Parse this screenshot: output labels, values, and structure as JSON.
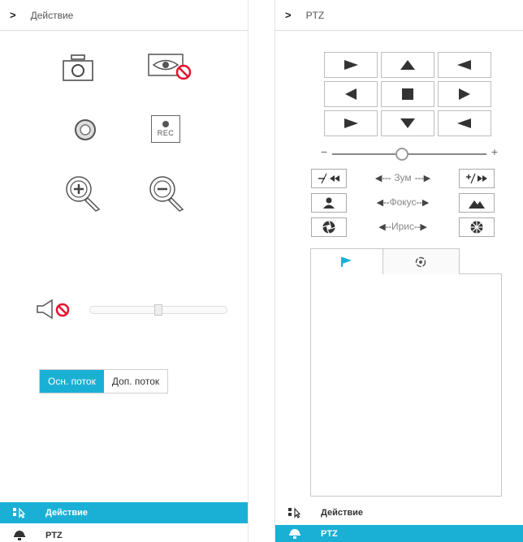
{
  "left_panel": {
    "header": {
      "chevron": ">",
      "title": "Действие"
    },
    "actions": {
      "snapshot": "camera-icon",
      "privacy_off": "eye-disabled-icon",
      "record_local": "record-circle-icon",
      "record_rec": "rec-icon",
      "rec_text": "REC",
      "zoom_in": "zoom-in-icon",
      "zoom_out": "zoom-out-icon"
    },
    "volume": {
      "icon": "speaker-muted-icon",
      "level": 0.5
    },
    "stream": {
      "main_label": "Осн. поток",
      "sub_label": "Доп. поток",
      "active": "main"
    },
    "nav": [
      {
        "label": "Действие",
        "icon": "action-cursor-icon",
        "active": true
      },
      {
        "label": "PTZ",
        "icon": "dome-camera-icon",
        "active": false
      }
    ]
  },
  "right_panel": {
    "header": {
      "chevron": ">",
      "title": "PTZ"
    },
    "dpad": [
      "up-left",
      "up",
      "up-right",
      "left",
      "stop",
      "right",
      "down-left",
      "down",
      "down-right"
    ],
    "speed": {
      "minus": "−",
      "plus": "+",
      "level": 0.45
    },
    "controls": [
      {
        "label": "Зум",
        "left_icon": "zoom-out-icon",
        "right_icon": "zoom-in-icon"
      },
      {
        "label": "Фокус",
        "left_icon": "focus-near-icon",
        "right_icon": "focus-far-icon"
      },
      {
        "label": "Ирис",
        "left_icon": "iris-close-icon",
        "right_icon": "iris-open-icon"
      }
    ],
    "tabs": [
      {
        "icon": "flag-icon",
        "active": true
      },
      {
        "icon": "tour-icon",
        "active": false
      }
    ],
    "nav": [
      {
        "label": "Действие",
        "icon": "action-cursor-icon",
        "active": false
      },
      {
        "label": "PTZ",
        "icon": "dome-camera-icon",
        "active": true
      }
    ]
  },
  "colors": {
    "accent": "#1ab0d6",
    "danger": "#e8112d",
    "border": "#c8c8c8"
  }
}
